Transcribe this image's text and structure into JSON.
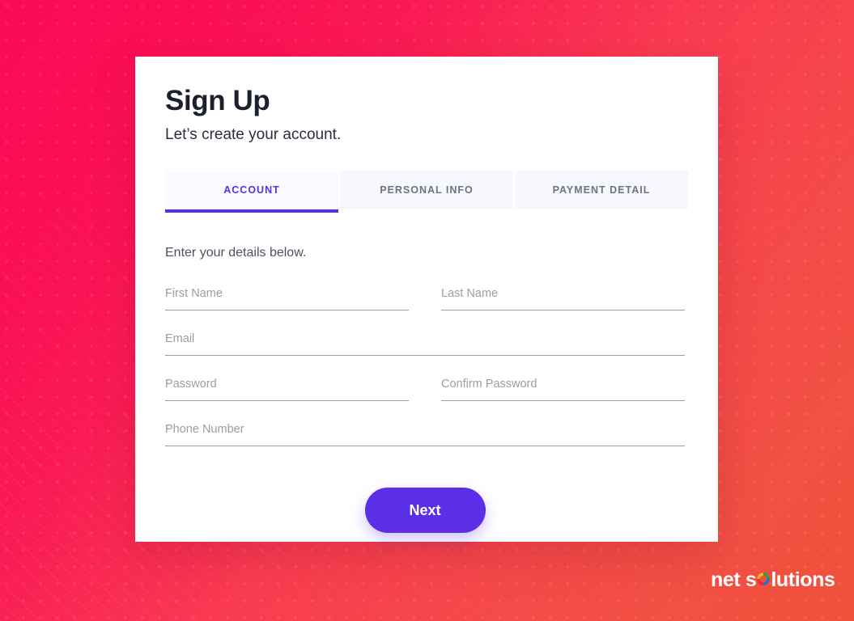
{
  "card": {
    "title": "Sign Up",
    "subtitle": "Let’s create your account.",
    "lead": "Enter your details below."
  },
  "tabs": [
    {
      "label": "ACCOUNT",
      "active": true
    },
    {
      "label": "PERSONAL INFO",
      "active": false
    },
    {
      "label": "PAYMENT DETAIL",
      "active": false
    }
  ],
  "form": {
    "fields": [
      {
        "name": "first-name",
        "placeholder": "First Name",
        "value": "",
        "width": "half"
      },
      {
        "name": "last-name",
        "placeholder": "Last Name",
        "value": "",
        "width": "half"
      },
      {
        "name": "email",
        "placeholder": "Email",
        "value": "",
        "width": "full"
      },
      {
        "name": "password",
        "placeholder": "Password",
        "value": "",
        "width": "half"
      },
      {
        "name": "confirm-password",
        "placeholder": "Confirm Password",
        "value": "",
        "width": "half"
      },
      {
        "name": "phone-number",
        "placeholder": "Phone Number",
        "value": "",
        "width": "full"
      }
    ],
    "submit_label": "Next"
  },
  "logo": {
    "text_before": "net s",
    "text_after": "lutions",
    "ring_icon": "multicolor-ring-icon"
  },
  "colors": {
    "accent_purple": "#5B2EE8",
    "title_dark": "#1B1F2E",
    "placeholder_gray": "#9B9DA6",
    "tab_bg": "#F7F8FD",
    "bg_pink": "#FB0A56",
    "bg_orange": "#EF5139",
    "card_white": "#FFFFFF"
  }
}
